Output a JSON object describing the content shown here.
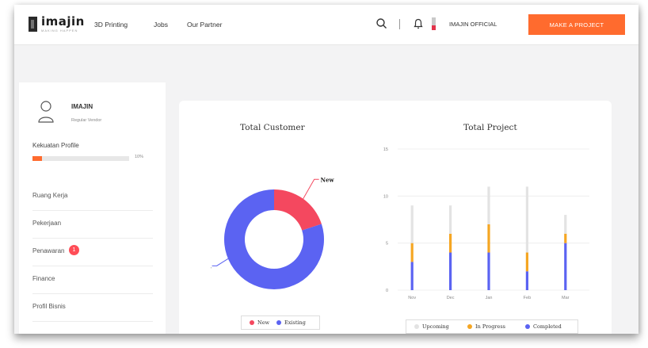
{
  "header": {
    "logo_text": "imajin",
    "logo_tagline": "MAKING HAPPEN",
    "nav": [
      "3D Printing",
      "Jobs",
      "Our Partner"
    ],
    "icons": [
      "search-icon",
      "bell-icon"
    ],
    "user_name": "IMAJIN OFFICIAL",
    "cta_label": "MAKE A PROJECT",
    "colors": {
      "accent": "#ff6b2e"
    }
  },
  "sidebar": {
    "profile_name": "IMAJIN",
    "profile_role": "Regular Vendor",
    "strength_label": "Kekuatan Profile",
    "strength_percent": 10,
    "strength_percent_label": "10%",
    "menu": [
      {
        "label": "Ruang Kerja"
      },
      {
        "label": "Pekerjaan"
      },
      {
        "label": "Penawaran",
        "badge": "1"
      },
      {
        "label": "Finance"
      },
      {
        "label": "Profil Bisnis"
      }
    ]
  },
  "main": {
    "customer_chart_title": "Total Customer",
    "project_chart_title": "Total Project"
  },
  "chart_data": [
    {
      "type": "pie",
      "title": "Total Customer",
      "categories": [
        "New",
        "Existing"
      ],
      "values": [
        20,
        80
      ],
      "slice_labels": [
        "New",
        "Exis..."
      ],
      "colors": [
        "#f4485f",
        "#5b63f2"
      ],
      "legend": [
        "New",
        "Existing"
      ],
      "legend_position": "bottom"
    },
    {
      "type": "bar",
      "title": "Total Project",
      "categories": [
        "Nov",
        "Dec",
        "Jan",
        "Feb",
        "Mar"
      ],
      "y_ticks": [
        0,
        5,
        10,
        15
      ],
      "ylim": [
        0,
        15
      ],
      "series": [
        {
          "name": "Completed",
          "color": "#5b63f2",
          "values": [
            3,
            4,
            4,
            2,
            5
          ]
        },
        {
          "name": "In Progress",
          "color": "#f5a623",
          "values": [
            2,
            2,
            3,
            2,
            1
          ]
        },
        {
          "name": "Upcoming",
          "color": "#e3e3e3",
          "values": [
            4,
            3,
            4,
            7,
            2
          ]
        }
      ],
      "legend": [
        "Upcoming",
        "In Progress",
        "Completed"
      ],
      "legend_position": "bottom",
      "grid": true
    }
  ]
}
